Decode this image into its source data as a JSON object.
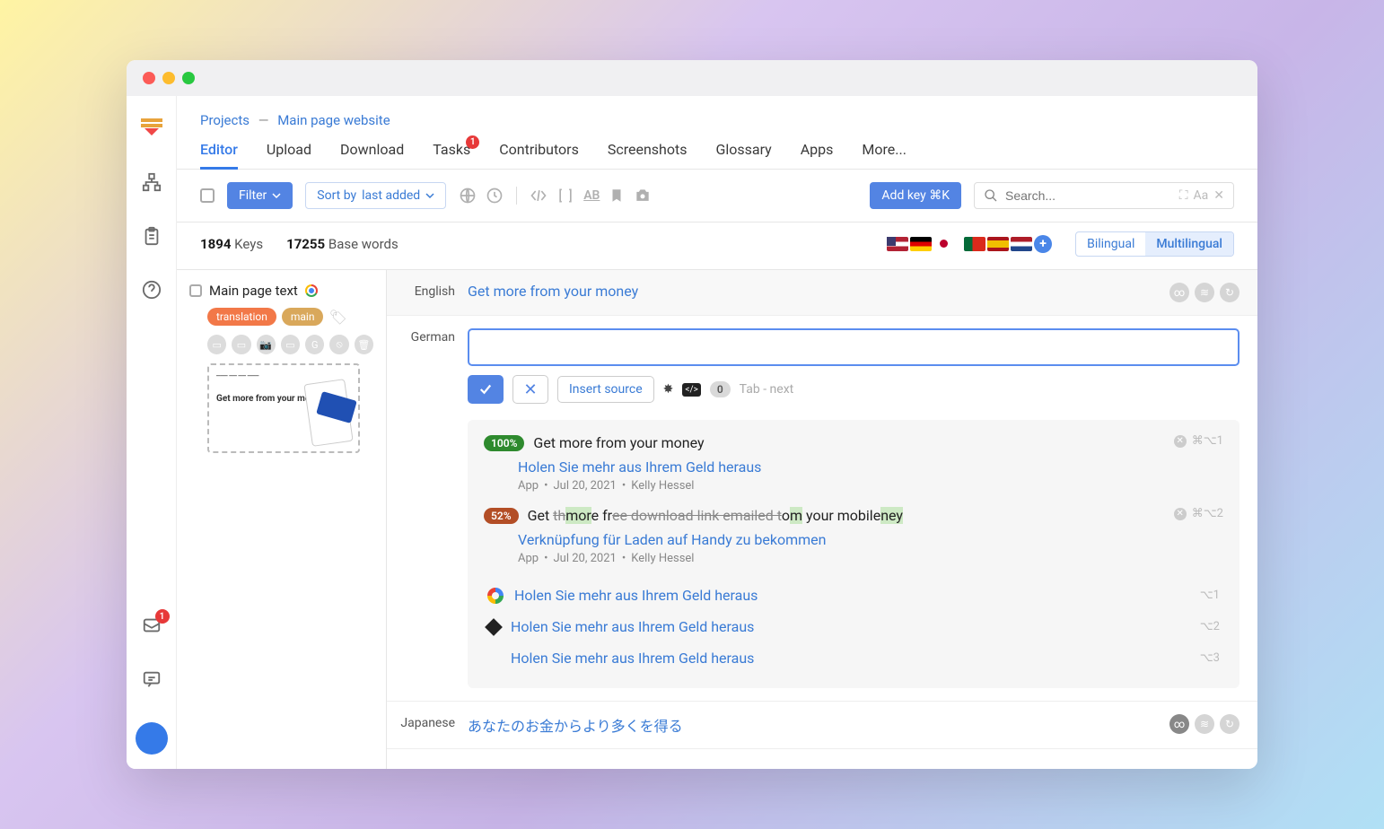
{
  "breadcrumb": {
    "root": "Projects",
    "sep": "—",
    "current": "Main page website"
  },
  "tabs": [
    "Editor",
    "Upload",
    "Download",
    "Tasks",
    "Contributors",
    "Screenshots",
    "Glossary",
    "Apps",
    "More..."
  ],
  "tabs_badge_index": 3,
  "tabs_badge": "1",
  "toolbar": {
    "filter": "Filter",
    "sort_prefix": "Sort by ",
    "sort_value": "last added",
    "addkey": "Add key ⌘K",
    "search_placeholder": "Search..."
  },
  "stats": {
    "keys_n": "1894",
    "keys_l": "Keys",
    "words_n": "17255",
    "words_l": "Base words"
  },
  "view": {
    "bilingual": "Bilingual",
    "multilingual": "Multilingual"
  },
  "key": {
    "name": "Main page text",
    "tags": [
      "translation",
      "main"
    ]
  },
  "langs": {
    "en_label": "English",
    "en_text": "Get more from your money",
    "de_label": "German",
    "jp_label": "Japanese",
    "jp_text": "あなたのお金からより多くを得る"
  },
  "actions": {
    "insert_source": "Insert source",
    "count": "0",
    "hint": "Tab - next"
  },
  "suggestions": {
    "s1": {
      "pct": "100%",
      "src": "Get more from your money",
      "trans": "Holen Sie mehr aus Ihrem Geld heraus",
      "meta_app": "App",
      "meta_date": "Jul 20, 2021",
      "meta_user": "Kelly Hessel",
      "shortcut": "⌘⌥1"
    },
    "s2": {
      "pct": "52%",
      "src_pre": "Get ",
      "src_diff1_del": "th",
      "src_diff1_ins": "mor",
      "src_diff1_plain": "e fr",
      "src_del2": "ee download link emailed t",
      "src_mid": "o",
      "src_ins2": "m",
      "src_plain3": " your mobile",
      "src_del3": "",
      "src_ins3": "ney",
      "trans": "Verknüpfung für Laden auf Handy zu bekommen",
      "meta_app": "App",
      "meta_date": "Jul 20, 2021",
      "meta_user": "Kelly Hessel",
      "shortcut": "⌘⌥2"
    },
    "mt": [
      {
        "provider": "google",
        "text": "Holen Sie mehr aus Ihrem Geld heraus",
        "key": "⌥1"
      },
      {
        "provider": "deepl",
        "text": "Holen Sie mehr aus Ihrem Geld heraus",
        "key": "⌥2"
      },
      {
        "provider": "ms",
        "text": "Holen Sie mehr aus Ihrem Geld heraus",
        "key": "⌥3"
      }
    ]
  },
  "leftnav_badge": "1",
  "thumb": {
    "title": "Get more from your money"
  }
}
